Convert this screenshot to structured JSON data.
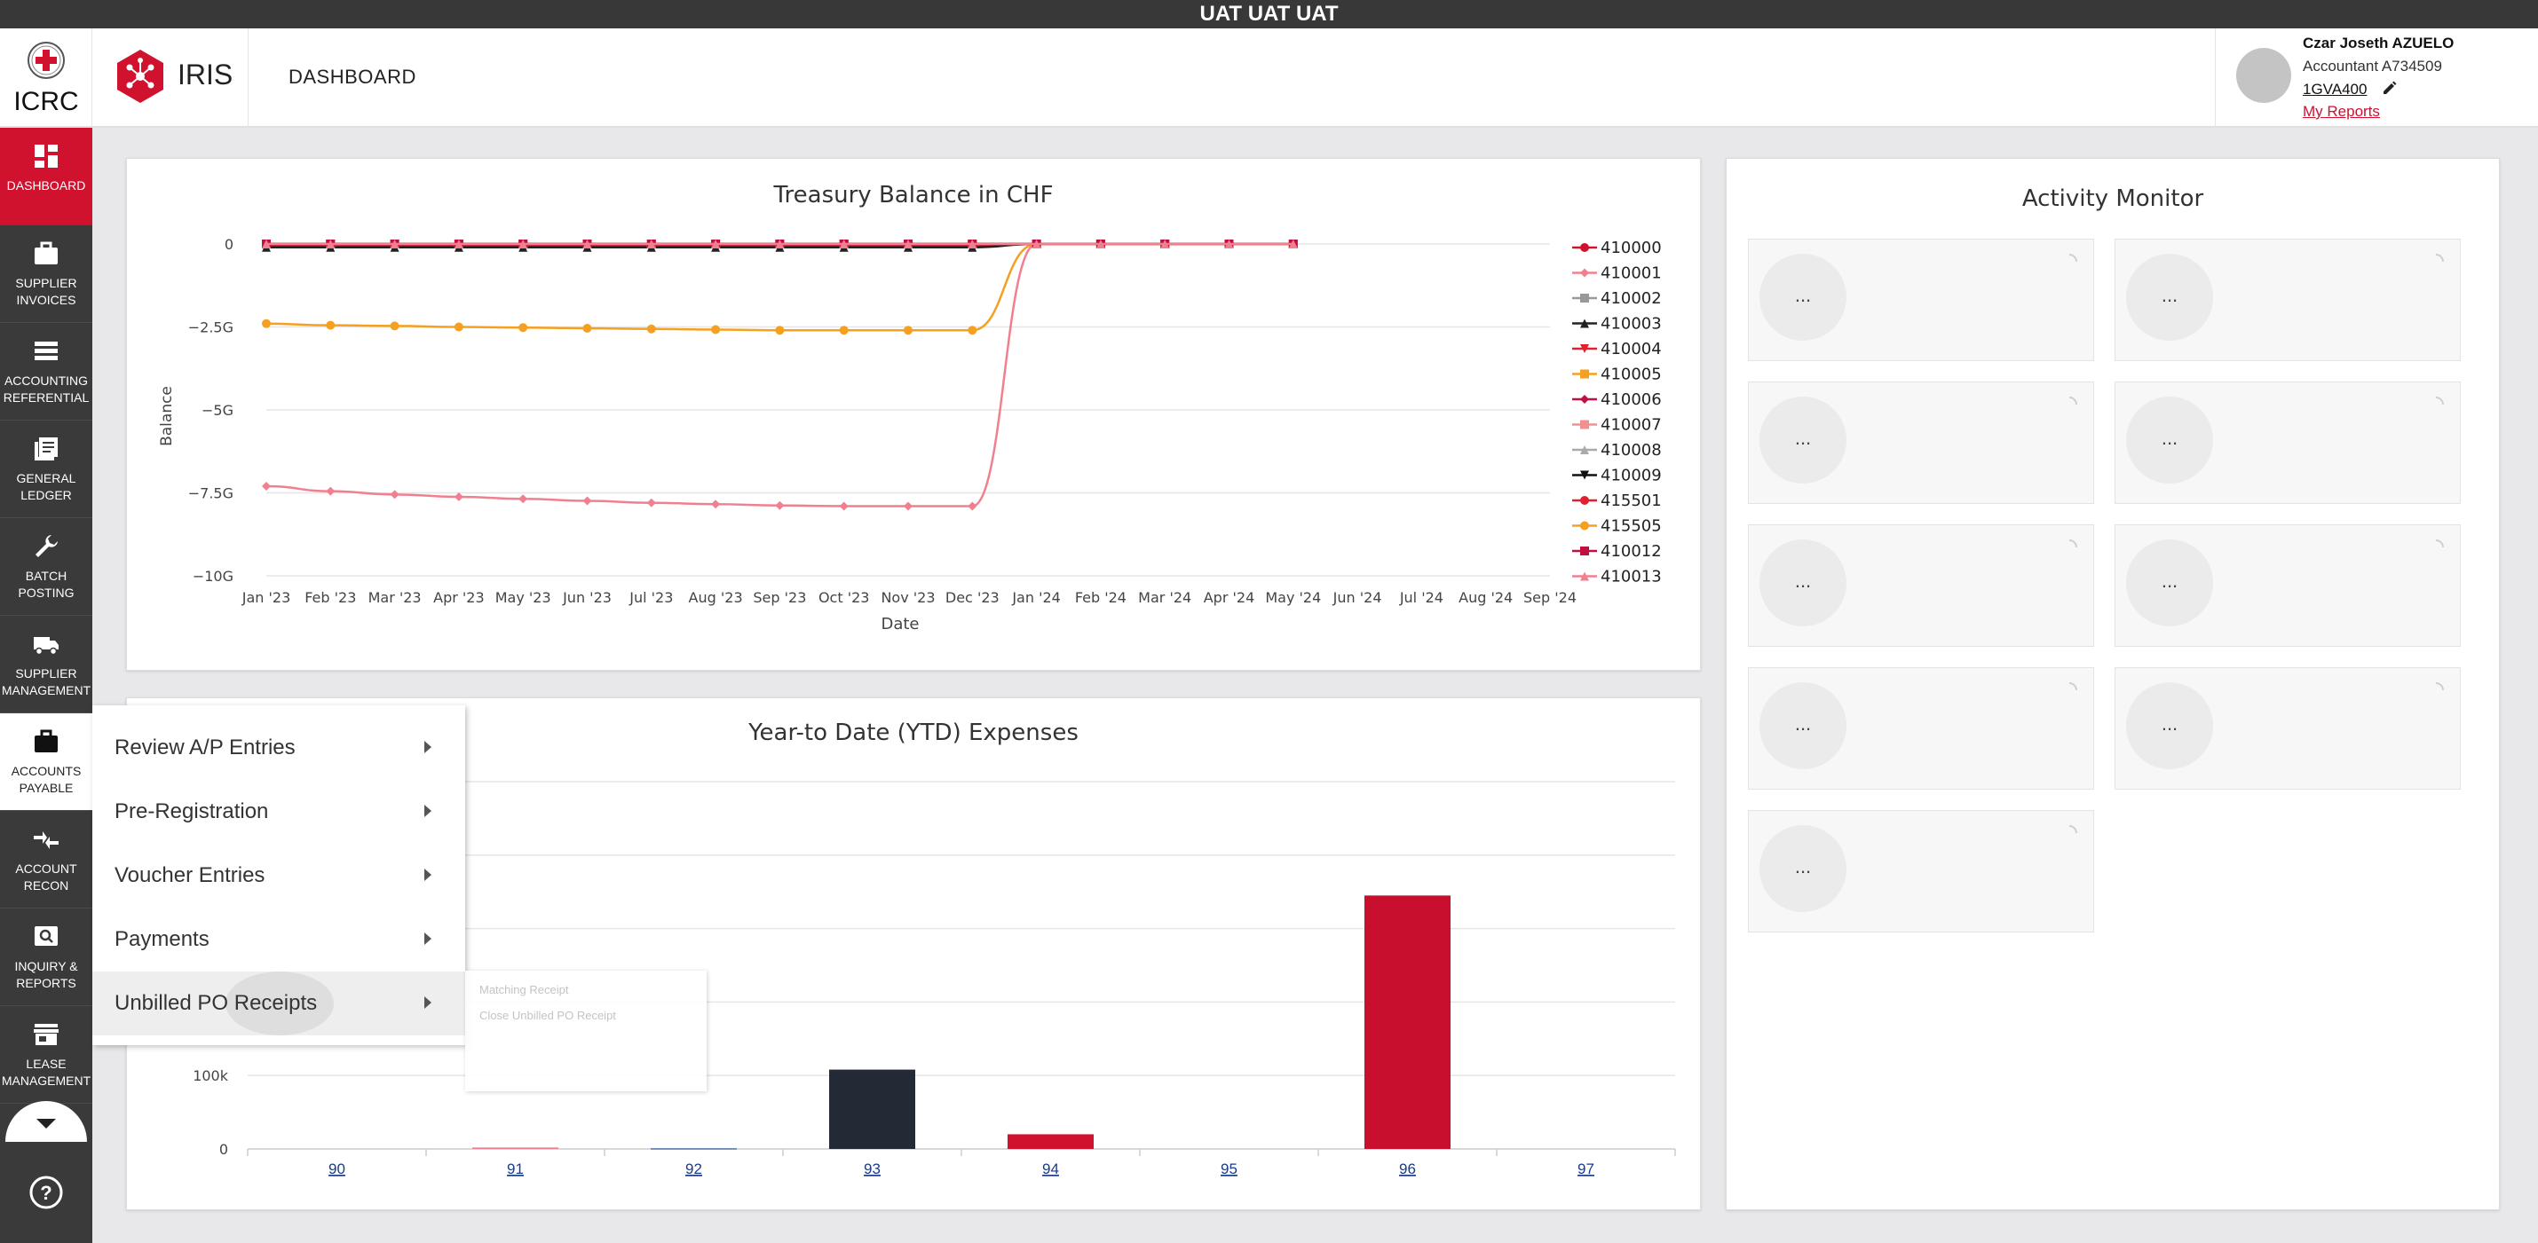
{
  "env_banner": "UAT UAT UAT",
  "header": {
    "org": "ICRC",
    "app_name": "IRIS",
    "page_title": "DASHBOARD",
    "user": {
      "name": "Czar Joseth AZUELO",
      "role": "Accountant A734509",
      "code": "1GVA400",
      "reports_link": "My Reports"
    }
  },
  "colors": {
    "brand_red": "#d0122f",
    "sidebar_bg": "#3a3a3a"
  },
  "sidebar": {
    "items": [
      {
        "label": "DASHBOARD",
        "icon": "dashboard-icon"
      },
      {
        "label": "SUPPLIER INVOICES",
        "icon": "briefcase-icon"
      },
      {
        "label": "ACCOUNTING REFERENTIAL",
        "icon": "list-icon"
      },
      {
        "label": "GENERAL LEDGER",
        "icon": "ledger-icon"
      },
      {
        "label": "BATCH POSTING",
        "icon": "wrench-icon"
      },
      {
        "label": "SUPPLIER MANAGEMENT",
        "icon": "truck-icon"
      },
      {
        "label": "ACCOUNTS PAYABLE",
        "icon": "briefcase-icon"
      },
      {
        "label": "ACCOUNT RECON",
        "icon": "compress-icon"
      },
      {
        "label": "INQUIRY & REPORTS",
        "icon": "search-icon"
      },
      {
        "label": "LEASE MANAGEMENT",
        "icon": "store-icon"
      }
    ]
  },
  "flyout": {
    "items": [
      {
        "label": "Review A/P Entries"
      },
      {
        "label": "Pre-Registration"
      },
      {
        "label": "Voucher Entries"
      },
      {
        "label": "Payments"
      },
      {
        "label": "Unbilled PO Receipts"
      }
    ],
    "submenu": [
      "Matching Receipt",
      "Close Unbilled PO Receipt"
    ]
  },
  "activity": {
    "title": "Activity Monitor",
    "tiles": [
      "...",
      "...",
      "...",
      "...",
      "...",
      "...",
      "...",
      "...",
      "..."
    ]
  },
  "chart_data": [
    {
      "type": "line",
      "title": "Treasury Balance in CHF",
      "xlabel": "Date",
      "ylabel": "Balance",
      "x": [
        "Jan '23",
        "Feb '23",
        "Mar '23",
        "Apr '23",
        "May '23",
        "Jun '23",
        "Jul '23",
        "Aug '23",
        "Sep '23",
        "Oct '23",
        "Nov '23",
        "Dec '23",
        "Jan '24",
        "Feb '24",
        "Mar '24",
        "Apr '24",
        "May '24",
        "Jun '24",
        "Jul '24",
        "Aug '24",
        "Sep '24"
      ],
      "yticks": [
        "0",
        "−2.5G",
        "−5G",
        "−7.5G",
        "−10G"
      ],
      "ylim": [
        -10,
        0
      ],
      "y_unit": "G",
      "legend_position": "right",
      "series": [
        {
          "name": "410000",
          "color": "#d0122f",
          "marker": "circle",
          "values": [
            -0.05,
            -0.05,
            -0.05,
            -0.05,
            -0.05,
            -0.05,
            -0.05,
            -0.05,
            -0.05,
            -0.05,
            -0.05,
            -0.05,
            0,
            0,
            0,
            0,
            0
          ]
        },
        {
          "name": "410001",
          "color": "#f08090",
          "marker": "diamond",
          "values": [
            -7.3,
            -7.45,
            -7.55,
            -7.62,
            -7.68,
            -7.74,
            -7.8,
            -7.84,
            -7.88,
            -7.9,
            -7.9,
            -7.9,
            0,
            0,
            0,
            0,
            0
          ]
        },
        {
          "name": "410002",
          "color": "#999999",
          "marker": "square",
          "values": [
            0,
            0,
            0,
            0,
            0,
            0,
            0,
            0,
            0,
            0,
            0,
            0,
            0,
            0,
            0,
            0,
            0
          ]
        },
        {
          "name": "410003",
          "color": "#222222",
          "marker": "triangle",
          "values": [
            -0.1,
            -0.1,
            -0.1,
            -0.1,
            -0.1,
            -0.1,
            -0.1,
            -0.1,
            -0.1,
            -0.1,
            -0.1,
            -0.1,
            0,
            0,
            0,
            0,
            0
          ]
        },
        {
          "name": "410004",
          "color": "#e02030",
          "marker": "triangle-down",
          "values": [
            0,
            0,
            0,
            0,
            0,
            0,
            0,
            0,
            0,
            0,
            0,
            0,
            0,
            0,
            0,
            0,
            0
          ]
        },
        {
          "name": "410005",
          "color": "#f5a020",
          "marker": "square",
          "values": [
            0,
            0,
            0,
            0,
            0,
            0,
            0,
            0,
            0,
            0,
            0,
            0,
            0,
            0,
            0,
            0,
            0
          ]
        },
        {
          "name": "410006",
          "color": "#c01040",
          "marker": "diamond",
          "values": [
            0,
            0,
            0,
            0,
            0,
            0,
            0,
            0,
            0,
            0,
            0,
            0,
            0,
            0,
            0,
            0,
            0
          ]
        },
        {
          "name": "410007",
          "color": "#f09090",
          "marker": "square",
          "values": [
            0,
            0,
            0,
            0,
            0,
            0,
            0,
            0,
            0,
            0,
            0,
            0,
            0,
            0,
            0,
            0,
            0
          ]
        },
        {
          "name": "410008",
          "color": "#aaaaaa",
          "marker": "triangle",
          "values": [
            0,
            0,
            0,
            0,
            0,
            0,
            0,
            0,
            0,
            0,
            0,
            0,
            0,
            0,
            0,
            0,
            0
          ]
        },
        {
          "name": "410009",
          "color": "#111111",
          "marker": "triangle-down",
          "values": [
            0,
            0,
            0,
            0,
            0,
            0,
            0,
            0,
            0,
            0,
            0,
            0,
            0,
            0,
            0,
            0,
            0
          ]
        },
        {
          "name": "415501",
          "color": "#e02030",
          "marker": "circle",
          "values": [
            0,
            0,
            0,
            0,
            0,
            0,
            0,
            0,
            0,
            0,
            0,
            0,
            0,
            0,
            0,
            0,
            0
          ]
        },
        {
          "name": "415505",
          "color": "#f5a020",
          "marker": "circle",
          "values": [
            -2.4,
            -2.45,
            -2.47,
            -2.5,
            -2.52,
            -2.54,
            -2.56,
            -2.58,
            -2.6,
            -2.6,
            -2.6,
            -2.6,
            0,
            0,
            0,
            0,
            0
          ]
        },
        {
          "name": "410012",
          "color": "#c01040",
          "marker": "square",
          "values": [
            0,
            0,
            0,
            0,
            0,
            0,
            0,
            0,
            0,
            0,
            0,
            0,
            0,
            0,
            0,
            0,
            0
          ]
        },
        {
          "name": "410013",
          "color": "#f08090",
          "marker": "triangle",
          "values": [
            0,
            0,
            0,
            0,
            0,
            0,
            0,
            0,
            0,
            0,
            0,
            0,
            0,
            0,
            0,
            0,
            0
          ]
        }
      ]
    },
    {
      "type": "bar",
      "title": "Year-to Date (YTD) Expenses",
      "categories": [
        "90",
        "91",
        "92",
        "93",
        "94",
        "95",
        "96",
        "97"
      ],
      "values": [
        0,
        2000,
        1000,
        108000,
        20000,
        0,
        345000,
        0
      ],
      "colors": [
        "#232a35",
        "#f08090",
        "#5577aa",
        "#232a35",
        "#d0122f",
        "#232a35",
        "#c8102e",
        "#232a35"
      ],
      "yticks": [
        "0",
        "100k"
      ],
      "ylim": [
        0,
        500000
      ]
    }
  ]
}
